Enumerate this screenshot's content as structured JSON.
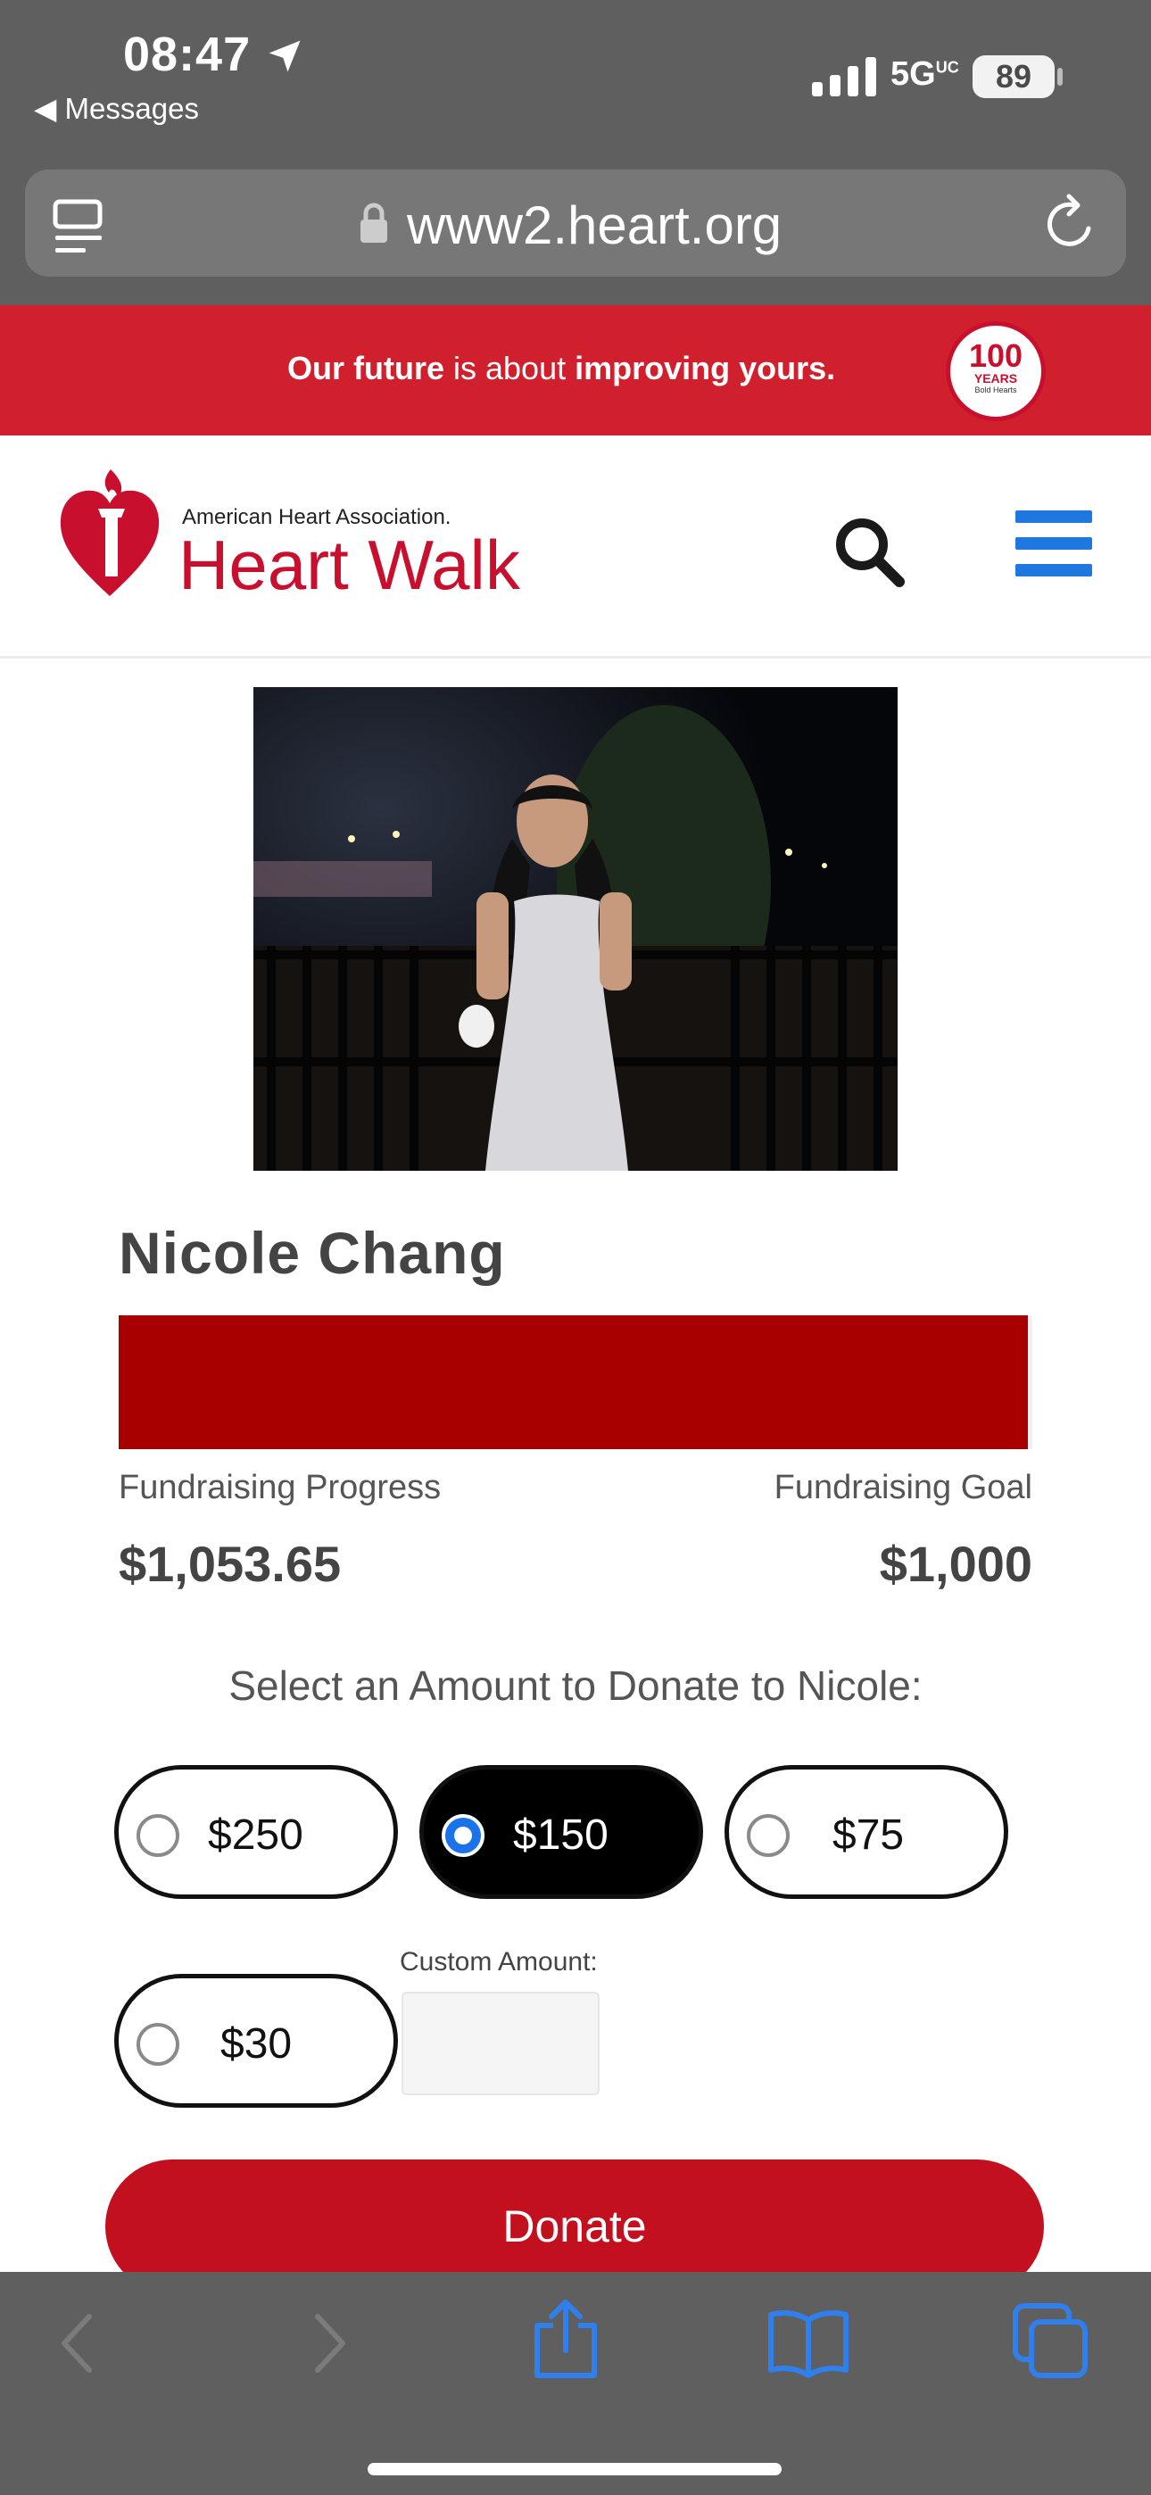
{
  "status_bar": {
    "time": "08:47",
    "back_app": "◀ Messages",
    "network": "5G",
    "network_suffix": "UC",
    "battery": "89"
  },
  "browser": {
    "url": "www2.heart.org"
  },
  "banner": {
    "part1": "Our future",
    "part2": " is about ",
    "part3": "improving yours.",
    "badge_number": "100",
    "badge_years": "YEARS",
    "badge_sub": "Bold Hearts"
  },
  "header": {
    "org_name": "American Heart Association.",
    "event_name": "Heart Walk"
  },
  "participant": {
    "name": "Nicole Chang",
    "progress_label": "Fundraising Progress",
    "goal_label": "Fundraising Goal",
    "raised": "$1,053.65",
    "goal": "$1,000",
    "progress_fraction": 0.995
  },
  "donation": {
    "prompt": "Select an Amount to Donate to Nicole:",
    "amounts": [
      {
        "label": "$250",
        "selected": false
      },
      {
        "label": "$150",
        "selected": true
      },
      {
        "label": "$75",
        "selected": false
      },
      {
        "label": "$30",
        "selected": false
      }
    ],
    "custom_label": "Custom Amount:",
    "custom_value": "",
    "button": "Donate"
  },
  "colors": {
    "brand_red": "#c8102e",
    "progress_fill": "#a80000",
    "menu_blue": "#1f77e0",
    "toolbar_gray": "#5f5f5f"
  }
}
